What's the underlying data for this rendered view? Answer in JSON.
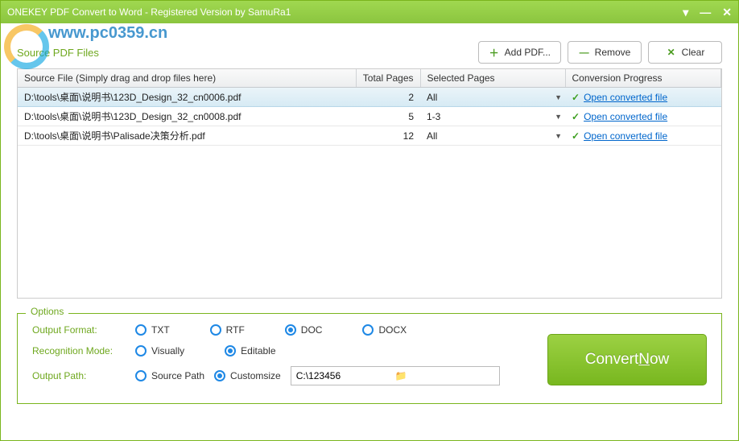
{
  "titlebar": {
    "title": "ONEKEY PDF Convert to Word - Registered Version by SamuRa1"
  },
  "watermark": {
    "text": "www.pc0359.cn"
  },
  "section": {
    "title": "Source PDF Files"
  },
  "toolbar": {
    "add_label": "Add PDF...",
    "remove_label": "Remove",
    "clear_label": "Clear"
  },
  "table": {
    "headers": {
      "source": "Source File (Simply drag and drop files here)",
      "total": "Total Pages",
      "selected": "Selected Pages",
      "progress": "Conversion Progress"
    },
    "rows": [
      {
        "source": "D:\\tools\\桌面\\说明书\\123D_Design_32_cn0006.pdf",
        "total": "2",
        "selected": "All",
        "progress": "Open converted file"
      },
      {
        "source": "D:\\tools\\桌面\\说明书\\123D_Design_32_cn0008.pdf",
        "total": "5",
        "selected": "1-3",
        "progress": "Open converted file"
      },
      {
        "source": "D:\\tools\\桌面\\说明书\\Palisade决策分析.pdf",
        "total": "12",
        "selected": "All",
        "progress": "Open converted file"
      }
    ]
  },
  "options": {
    "legend": "Options",
    "output_format_label": "Output Format:",
    "recognition_mode_label": "Recognition Mode:",
    "output_path_label": "Output Path:",
    "formats": {
      "txt": "TXT",
      "rtf": "RTF",
      "doc": "DOC",
      "docx": "DOCX"
    },
    "modes": {
      "visually": "Visually",
      "editable": "Editable"
    },
    "paths": {
      "source": "Source Path",
      "custom": "Customsize"
    },
    "path_value": "C:\\123456",
    "selected_format": "doc",
    "selected_mode": "editable",
    "selected_path": "custom"
  },
  "convert": {
    "label_prefix": "Convert ",
    "label_key": "N",
    "label_suffix": "ow"
  }
}
